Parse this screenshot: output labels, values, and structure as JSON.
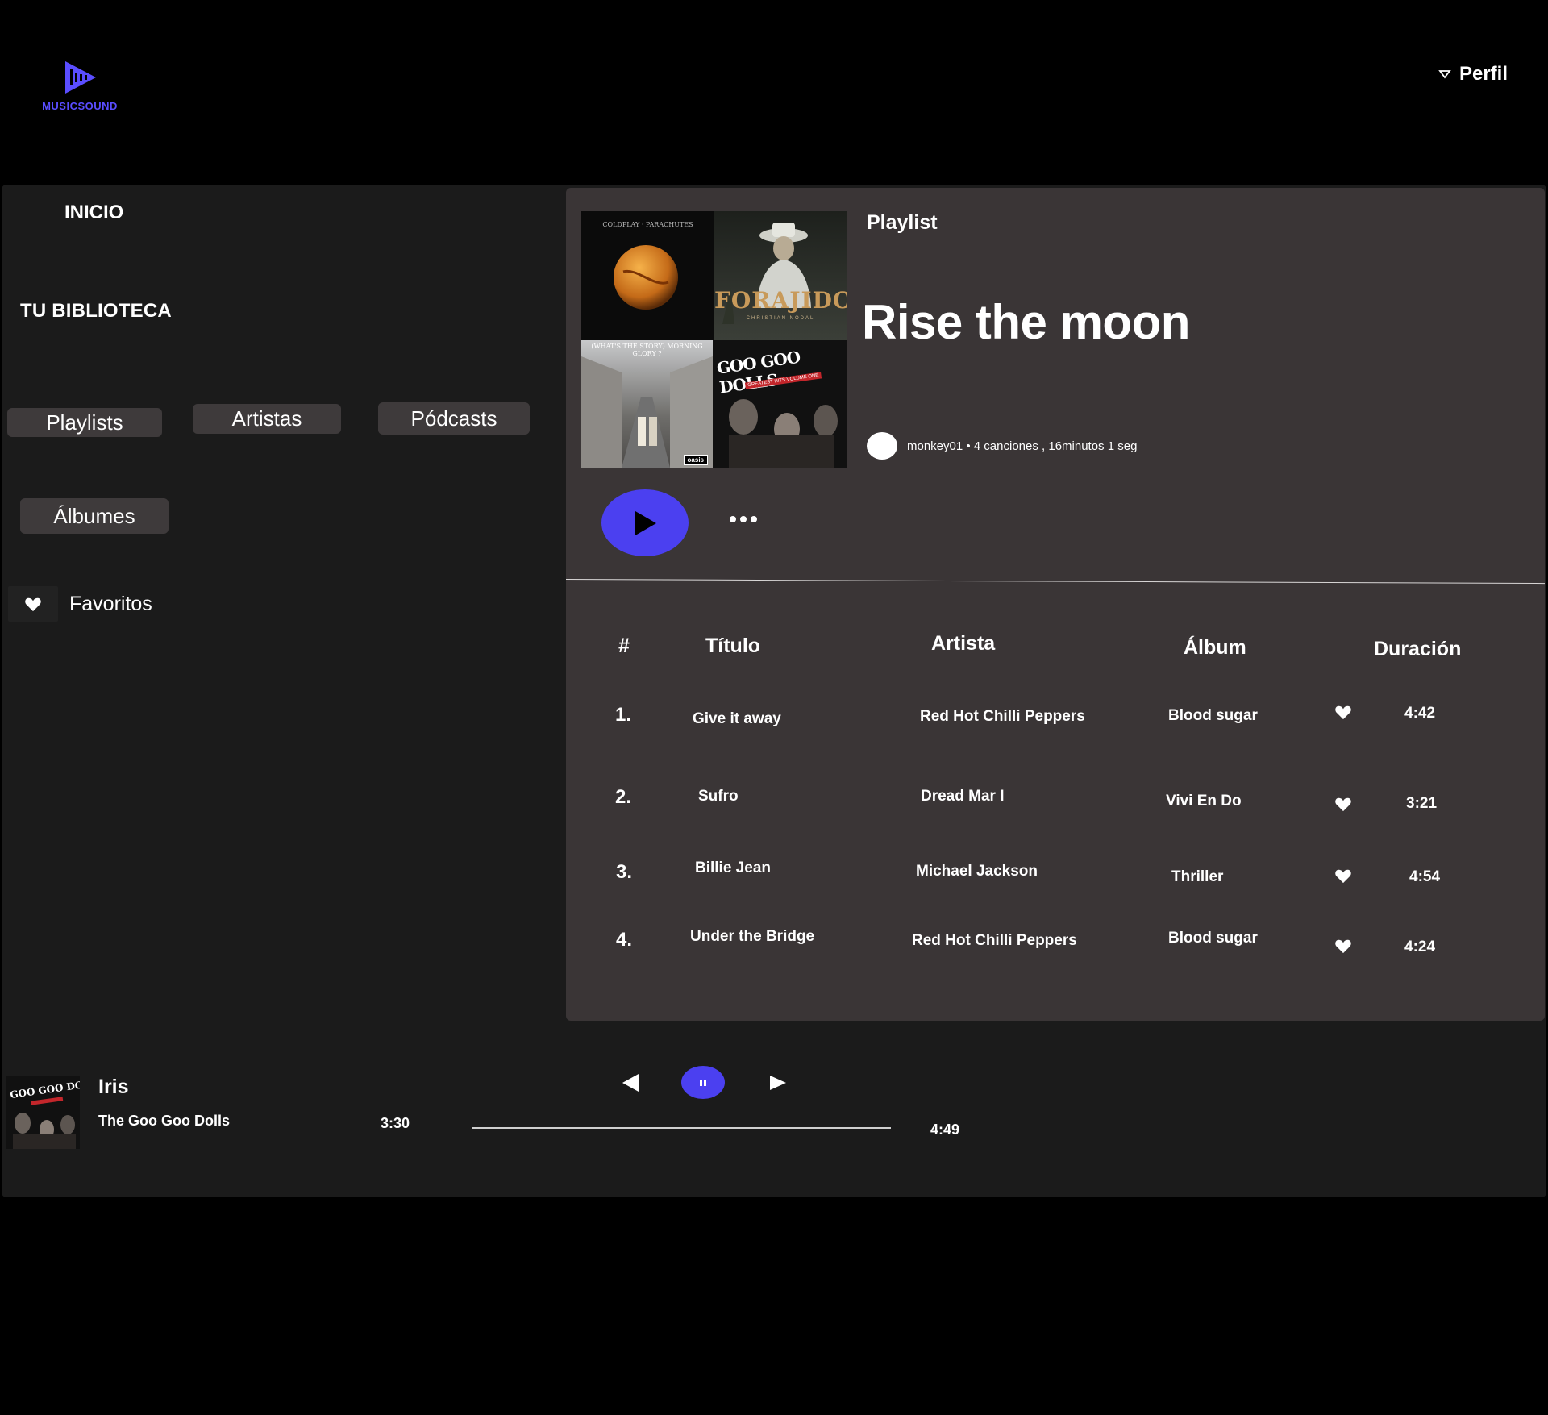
{
  "app": {
    "logo_text": "MUSICSOUND",
    "profile_label": "Perfil",
    "accent_color": "#4b40f0"
  },
  "sidebar": {
    "home_label": "INICIO",
    "library_label": "TU BIBLIOTECA",
    "filters": [
      "Playlists",
      "Artistas",
      "Pódcasts",
      "Álbumes"
    ],
    "favorites_label": "Favoritos"
  },
  "playlist": {
    "kind": "Playlist",
    "title": "Rise the moon",
    "meta": "monkey01 • 4 canciones , 16minutos  1 seg",
    "cover_texts": {
      "c1": "COLDPLAY · PARACHUTES",
      "c2": "FORAJIDO",
      "c2_sub": "CHRISTIAN NODAL",
      "c3": "(WHAT'S THE STORY) MORNING GLORY ?",
      "c3_badge": "oasis",
      "c4": "GOO GOO DOLLS",
      "c4_sub": "GREATEST HITS VOLUME ONE"
    }
  },
  "table": {
    "headers": {
      "num": "#",
      "title": "Título",
      "artist": "Artista",
      "album": "Álbum",
      "duration": "Duración"
    },
    "rows": [
      {
        "num": "1.",
        "title": "Give it away",
        "artist": "Red Hot Chilli Peppers",
        "album": "Blood sugar",
        "duration": "4:42"
      },
      {
        "num": "2.",
        "title": "Sufro",
        "artist": "Dread Mar I",
        "album": "Vivi En Do",
        "duration": "3:21"
      },
      {
        "num": "3.",
        "title": "Billie Jean",
        "artist": "Michael Jackson",
        "album": "Thriller",
        "duration": "4:54"
      },
      {
        "num": "4.",
        "title": "Under the Bridge",
        "artist": "Red Hot Chilli Peppers",
        "album": "Blood sugar",
        "duration": "4:24"
      }
    ]
  },
  "player": {
    "title": "Iris",
    "artist": "The Goo Goo Dolls",
    "current_time": "3:30",
    "total_time": "4:49",
    "cover_text": "GOO GOO DOLLS"
  }
}
